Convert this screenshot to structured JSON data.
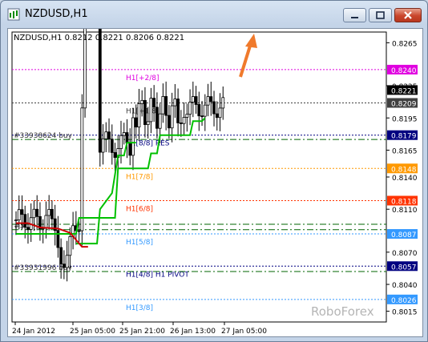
{
  "window": {
    "title": "NZDUSD,H1"
  },
  "chart_header": "NZDUSD,H1  0.8212 0.8221 0.8206 0.8221",
  "watermark": "RoboForex",
  "price_scale": {
    "ticks": [
      "0.8265",
      "0.8225",
      "0.8195",
      "0.8165",
      "0.8140",
      "0.8110",
      "0.8070",
      "0.8040",
      "0.8015"
    ],
    "ticks_values": [
      0.8265,
      0.8225,
      0.8195,
      0.8165,
      0.814,
      0.811,
      0.807,
      0.804,
      0.8015
    ]
  },
  "time_scale": [
    "24 Jan 2012",
    "25 Jan 05:00",
    "25 Jan 21:00",
    "26 Jan 13:00",
    "27 Jan 05:00"
  ],
  "levels": [
    {
      "label": "H1[+2/8]",
      "price": 0.824,
      "price_text": "0.8240",
      "color": "#e000e0",
      "badge_text_color": "#ffffff"
    },
    {
      "label": "H1[+1/8]",
      "price": 0.8209,
      "price_text": "0.8209",
      "color": "#404040",
      "badge_text_color": "#ffffff"
    },
    {
      "label": "H1[8/8] RES",
      "price": 0.8179,
      "price_text": "0.8179",
      "color": "#000080",
      "badge_text_color": "#ffffff"
    },
    {
      "label": "H1[7/8]",
      "price": 0.8148,
      "price_text": "0.8148",
      "color": "#ff9900",
      "badge_text_color": "#ffffff"
    },
    {
      "label": "H1[6/8]",
      "price": 0.8118,
      "price_text": "0.8118",
      "color": "#ff3300",
      "badge_text_color": "#ffffff"
    },
    {
      "label": "H1[5/8]",
      "price": 0.8087,
      "price_text": "0.8087",
      "color": "#3399ff",
      "badge_text_color": "#ffffff"
    },
    {
      "label": "H1[4/8] H1 PIVOT",
      "price": 0.8057,
      "price_text": "0.8057",
      "color": "#000080",
      "badge_text_color": "#ffffff"
    },
    {
      "label": "H1[3/8]",
      "price": 0.8026,
      "price_text": "0.8026",
      "color": "#3399ff",
      "badge_text_color": "#ffffff"
    }
  ],
  "order_lines": [
    {
      "label": "#33938624 buy",
      "price": 0.8175,
      "color": "#006400"
    },
    {
      "label": "#33931996 buy",
      "price": 0.8052,
      "color": "#006400"
    },
    {
      "label": "",
      "price": 0.8096,
      "color": "#006400"
    },
    {
      "label": "#3",
      "price": 0.8091,
      "color": "#006400"
    }
  ],
  "current_price": {
    "price": 0.8221,
    "text": "0.8221",
    "color": "#000000"
  },
  "arrow": {
    "direction": "up-right",
    "color": "#f07a2c"
  },
  "chart_data": {
    "type": "line",
    "series": [
      {
        "color": "#00c000",
        "values": [
          [
            0,
            0.8087
          ],
          [
            20,
            0.8087
          ],
          [
            21,
            0.8102
          ],
          [
            33,
            0.8102
          ],
          [
            34,
            0.8148
          ],
          [
            44,
            0.8148
          ],
          [
            45,
            0.8162
          ],
          [
            47,
            0.8162
          ],
          [
            48,
            0.8179
          ],
          [
            58,
            0.8179
          ],
          [
            59,
            0.8192
          ],
          [
            62,
            0.8192
          ],
          [
            63,
            0.8195
          ]
        ]
      },
      {
        "color": "#00c000",
        "values": [
          [
            20,
            0.8078
          ],
          [
            27,
            0.8078
          ],
          [
            28,
            0.811
          ],
          [
            32,
            0.8125
          ],
          [
            34,
            0.816
          ],
          [
            36,
            0.816
          ],
          [
            37,
            0.8172
          ],
          [
            40,
            0.8172
          ]
        ]
      },
      {
        "color": "#cc0000",
        "values": [
          [
            0,
            0.8097
          ],
          [
            4,
            0.8097
          ],
          [
            8,
            0.8093
          ],
          [
            14,
            0.8092
          ],
          [
            18,
            0.8088
          ],
          [
            22,
            0.8075
          ],
          [
            24,
            0.8075
          ]
        ]
      }
    ]
  }
}
